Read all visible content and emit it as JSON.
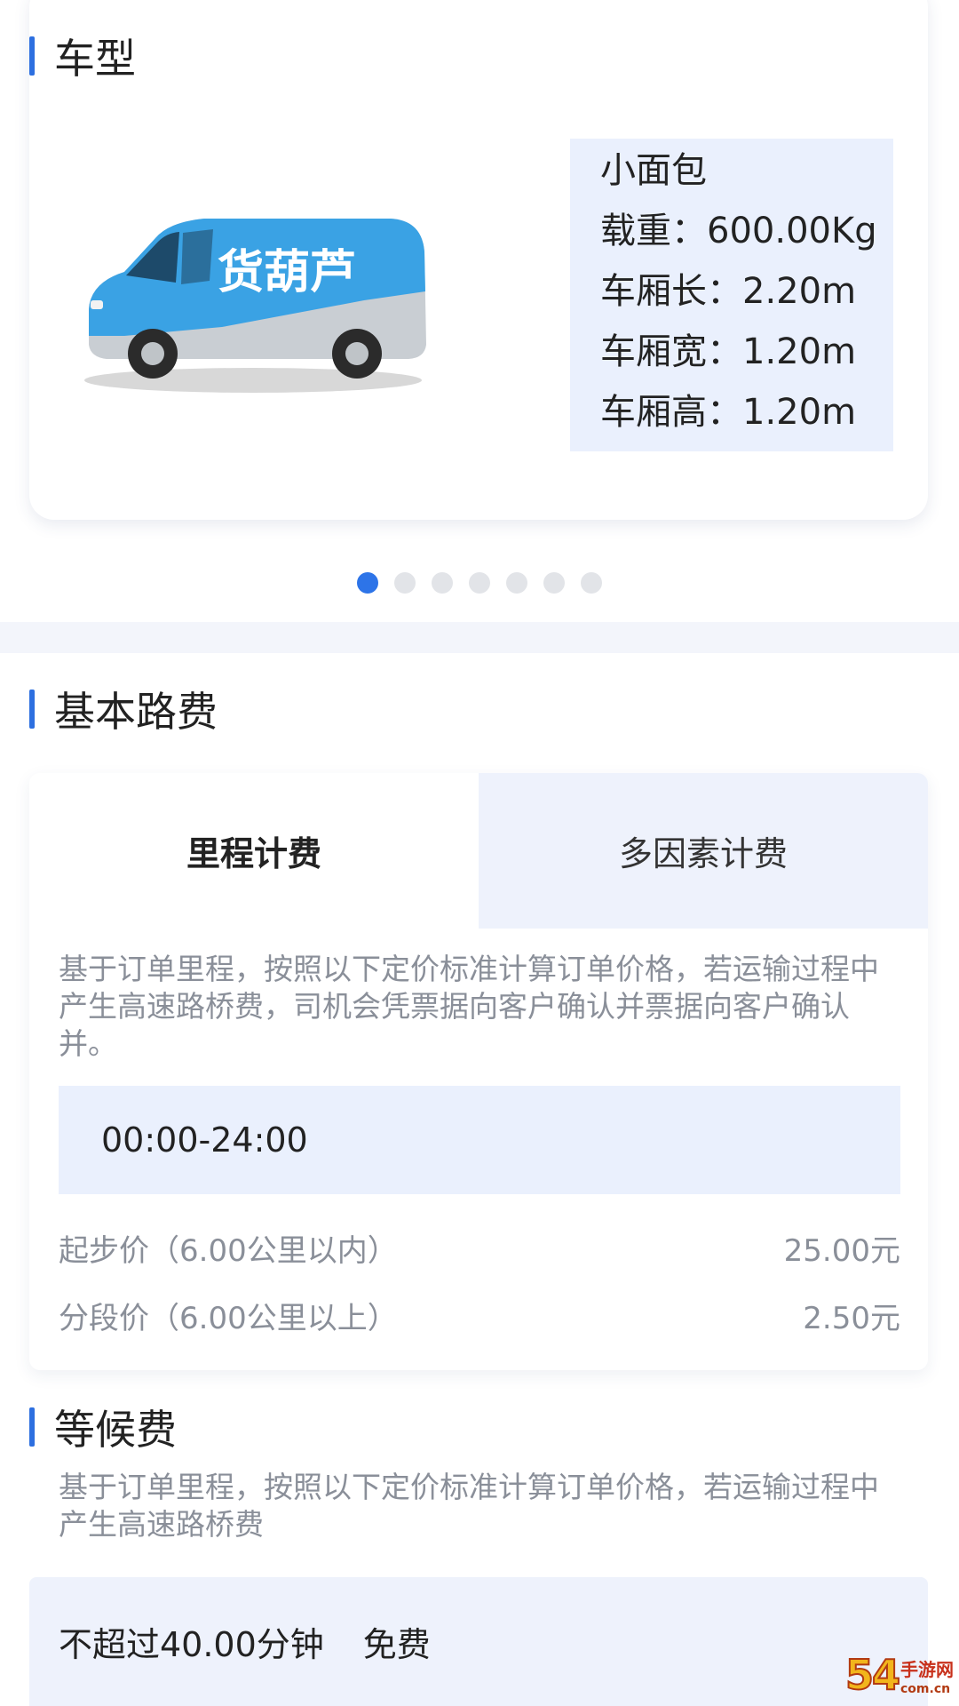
{
  "vehicle": {
    "section_title": "车型",
    "image_brand_text": "货葫芦",
    "name": "小面包",
    "specs": [
      {
        "label": "载重：",
        "value": "600.00Kg"
      },
      {
        "label": "车厢长：",
        "value": "2.20m"
      },
      {
        "label": "车厢宽：",
        "value": "1.20m"
      },
      {
        "label": "车厢高：",
        "value": "1.20m"
      }
    ],
    "pager": {
      "total": 7,
      "active_index": 0
    }
  },
  "fee": {
    "section_title": "基本路费",
    "tabs": [
      {
        "label": "里程计费",
        "active": true
      },
      {
        "label": "多因素计费",
        "active": false
      }
    ],
    "description": "基于订单里程，按照以下定价标准计算订单价格，若运输过程中产生高速路桥费，司机会凭票据向客户确认并票据向客户确认并。",
    "time_range": "00:00-24:00",
    "price_rows": [
      {
        "label": "起步价（6.00公里以内）",
        "value": "25.00元"
      },
      {
        "label": "分段价（6.00公里以上）",
        "value": "2.50元"
      }
    ]
  },
  "waiting": {
    "section_title": "等候费",
    "description": "基于订单里程，按照以下定价标准计算订单价格，若运输过程中产生高速路桥费",
    "rule": "不超过40.00分钟",
    "rule_value": "免费"
  },
  "watermark": {
    "big": "54",
    "small": "手游网",
    "domain": "com.cn"
  },
  "colors": {
    "accent": "#2d6fe0",
    "light_panel": "#eaf0fd",
    "muted_text": "#8a8f99"
  }
}
